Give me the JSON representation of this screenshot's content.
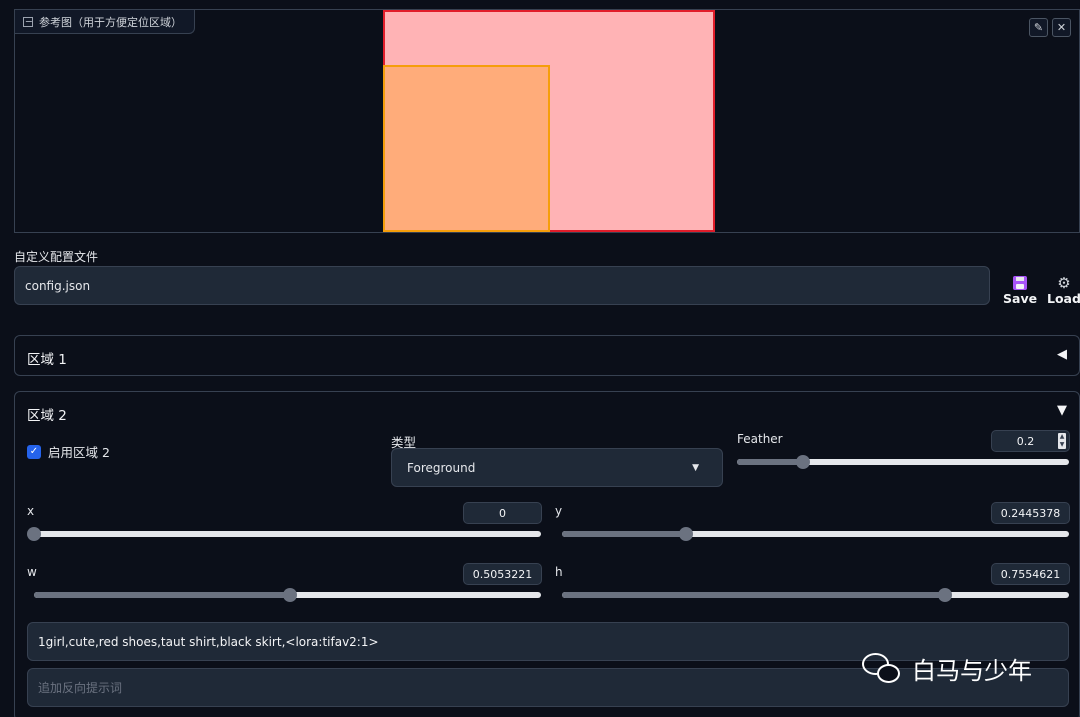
{
  "reference": {
    "label": "参考图（用于方便定位区域）",
    "edit_icon": "pencil-icon",
    "close_icon": "close-icon",
    "region_colors": {
      "region1": "#ffb3b5",
      "region1_border": "#e11d2a",
      "region2": "#ffac7a",
      "region2_border": "#f59e0b"
    }
  },
  "config": {
    "label": "自定义配置文件",
    "value": "config.json",
    "save_label": "Save",
    "load_label": "Load",
    "save_icon": "floppy-disk-icon",
    "load_icon": "gear-icon"
  },
  "region1": {
    "title": "区域 1",
    "arrow": "◀"
  },
  "region2": {
    "title": "区域 2",
    "arrow": "▼",
    "enable_label": "启用区域 2",
    "enabled": true,
    "type_label": "类型",
    "type_value": "Foreground",
    "feather_label": "Feather",
    "feather_value": "0.2",
    "feather_fraction": 0.2,
    "x_label": "x",
    "x_value": "0",
    "x_fraction": 0,
    "y_label": "y",
    "y_value": "0.2445378",
    "y_fraction": 0.2445378,
    "w_label": "w",
    "w_value": "0.5053221",
    "w_fraction": 0.5053221,
    "h_label": "h",
    "h_value": "0.7554621",
    "h_fraction": 0.7554621,
    "prompt": "1girl,cute,red shoes,taut shirt,black skirt,<lora:tifav2:1>",
    "negative_placeholder": "追加反向提示词"
  },
  "watermark": {
    "text": "白马与少年",
    "icon": "wechat-icon"
  },
  "accent_color": "#2563eb"
}
